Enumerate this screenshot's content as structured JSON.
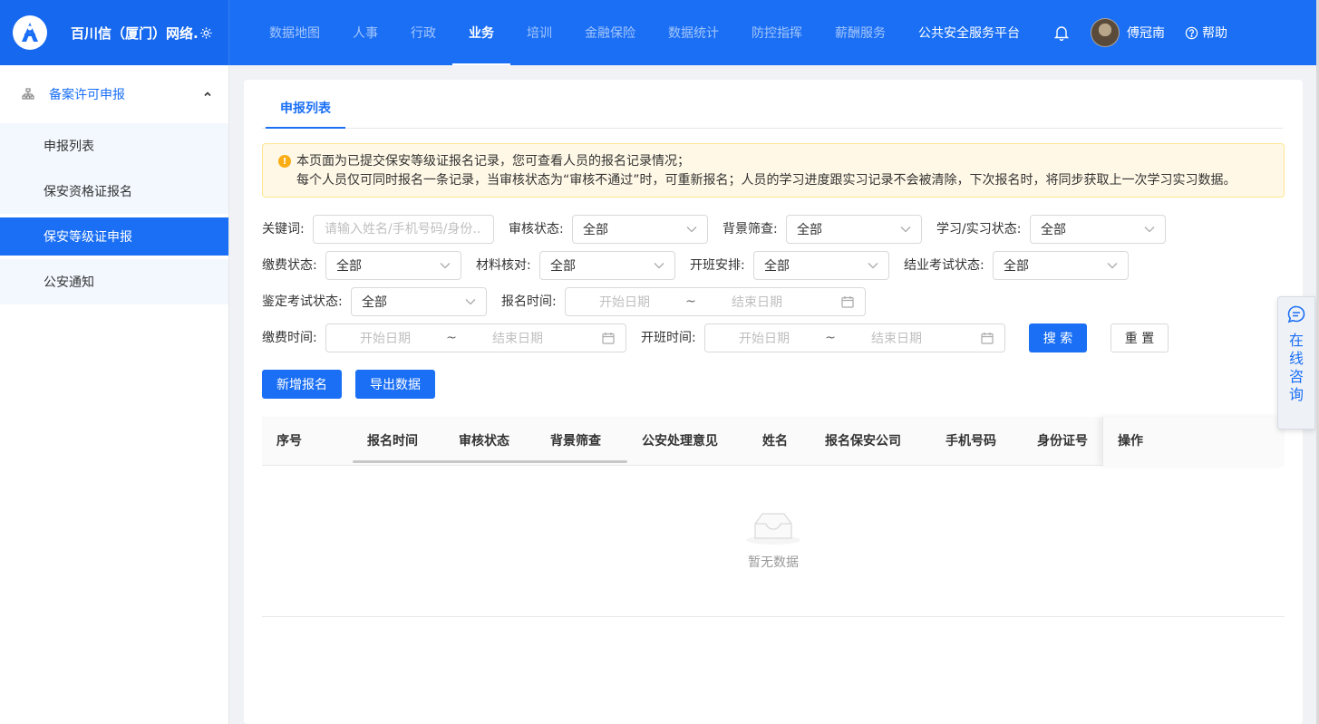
{
  "header": {
    "brand": "百川信（厦门）网络...",
    "nav": [
      {
        "label": "数据地图"
      },
      {
        "label": "人事"
      },
      {
        "label": "行政"
      },
      {
        "label": "业务"
      },
      {
        "label": "培训"
      },
      {
        "label": "金融保险"
      },
      {
        "label": "数据统计"
      },
      {
        "label": "防控指挥"
      },
      {
        "label": "薪酬服务"
      },
      {
        "label": "公共安全服务平台"
      }
    ],
    "active_nav": "业务",
    "user": "傅冠南",
    "help": "帮助"
  },
  "sidebar": {
    "group": "备案许可申报",
    "items": [
      {
        "label": "申报列表"
      },
      {
        "label": "保安资格证报名"
      },
      {
        "label": "保安等级证申报"
      },
      {
        "label": "公安通知"
      }
    ],
    "active_item": "保安等级证申报"
  },
  "tab": "申报列表",
  "notice": {
    "line1": "本页面为已提交保安等级证报名记录，您可查看人员的报名记录情况；",
    "line2": "每个人员仅可同时报名一条记录，当审核状态为“审核不通过”时，可重新报名；人员的学习进度跟实习记录不会被清除，下次报名时，将同步获取上一次学习实习数据。"
  },
  "filters": {
    "keyword": {
      "label": "关键词:",
      "placeholder": "请输入姓名/手机号码/身份..."
    },
    "audit_status": {
      "label": "审核状态:",
      "value": "全部"
    },
    "background_check": {
      "label": "背景筛查:",
      "value": "全部"
    },
    "study_status": {
      "label": "学习/实习状态:",
      "value": "全部"
    },
    "payment_status": {
      "label": "缴费状态:",
      "value": "全部"
    },
    "material_check": {
      "label": "材料核对:",
      "value": "全部"
    },
    "class_arrangement": {
      "label": "开班安排:",
      "value": "全部"
    },
    "graduation_exam": {
      "label": "结业考试状态:",
      "value": "全部"
    },
    "appraisal_exam": {
      "label": "鉴定考试状态:",
      "value": "全部"
    },
    "signup_time": {
      "label": "报名时间:",
      "start": "开始日期",
      "end": "结束日期"
    },
    "payment_time": {
      "label": "缴费时间:",
      "start": "开始日期",
      "end": "结束日期"
    },
    "class_time": {
      "label": "开班时间:",
      "start": "开始日期",
      "end": "结束日期"
    },
    "range_sep": "~"
  },
  "buttons": {
    "search": "搜 索",
    "reset": "重 置",
    "add": "新增报名",
    "export": "导出数据"
  },
  "table": {
    "columns": [
      "序号",
      "报名时间",
      "审核状态",
      "背景筛查",
      "公安处理意见",
      "姓名",
      "报名保安公司",
      "手机号码",
      "身份证号",
      "操作"
    ],
    "empty_text": "暂无数据"
  },
  "consult": "在线咨询"
}
